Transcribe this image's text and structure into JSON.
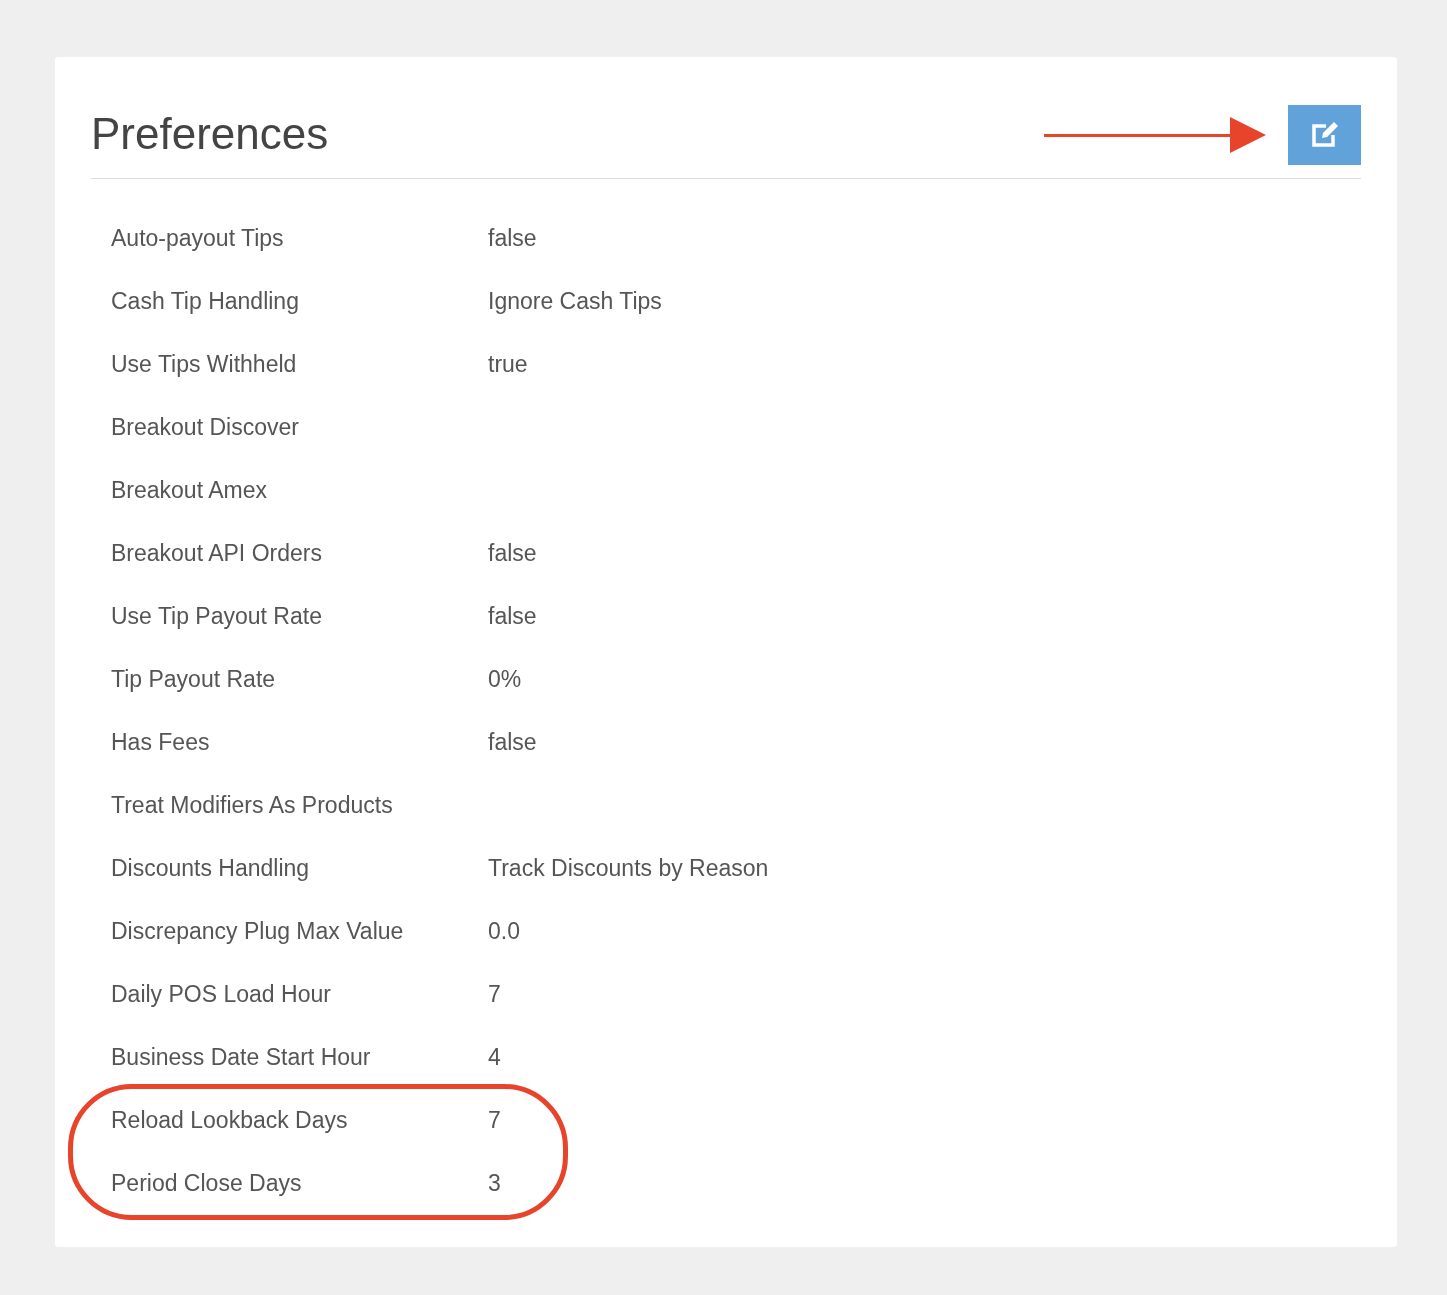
{
  "panel": {
    "title": "Preferences",
    "edit_button": {
      "pointed_at": true
    }
  },
  "rows": [
    {
      "label": "Auto-payout Tips",
      "value": "false",
      "circled": false
    },
    {
      "label": "Cash Tip Handling",
      "value": "Ignore Cash Tips",
      "circled": false
    },
    {
      "label": "Use Tips Withheld",
      "value": "true",
      "circled": false
    },
    {
      "label": "Breakout Discover",
      "circled": false
    },
    {
      "label": "Breakout Amex",
      "circled": false
    },
    {
      "label": "Breakout API Orders",
      "value": "false",
      "circled": false
    },
    {
      "label": "Use Tip Payout Rate",
      "value": "false",
      "circled": false
    },
    {
      "label": "Tip Payout Rate",
      "value": "0%",
      "circled": false
    },
    {
      "label": "Has Fees",
      "value": "false",
      "circled": false
    },
    {
      "label": "Treat Modifiers As Products",
      "circled": false
    },
    {
      "label": "Discounts Handling",
      "value": "Track Discounts by Reason",
      "circled": false
    },
    {
      "label": "Discrepancy Plug Max Value",
      "value": "0.0",
      "circled": false
    },
    {
      "label": "Daily POS Load Hour",
      "value": "7",
      "circled": false
    },
    {
      "label": "Business Date Start Hour",
      "value": "4",
      "circled": false
    },
    {
      "label": "Reload Lookback Days",
      "value": "7",
      "circled": true
    },
    {
      "label": "Period Close Days",
      "value": "3",
      "circled": true
    }
  ]
}
